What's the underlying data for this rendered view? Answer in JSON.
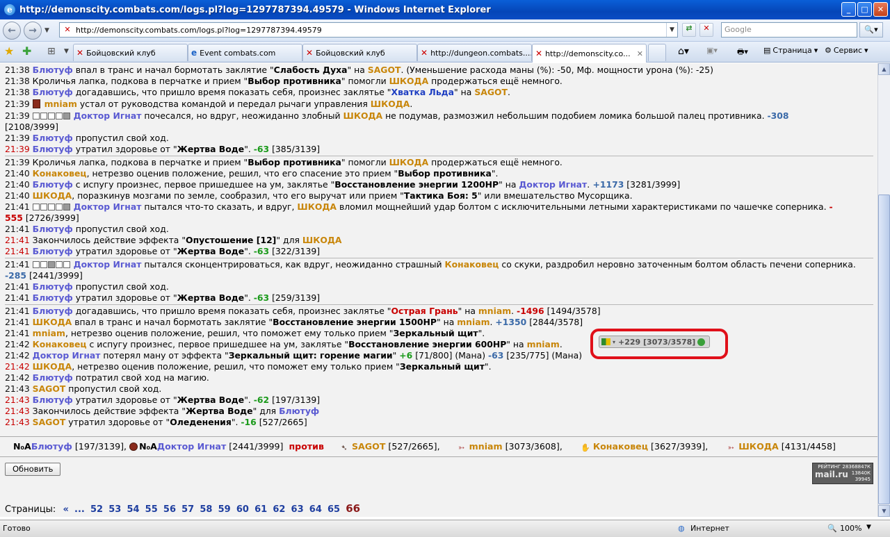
{
  "window": {
    "title": "http://demonscity.combats.com/logs.pl?log=1297787394.49579 - Windows Internet Explorer",
    "btn_min": "_",
    "btn_max": "□",
    "btn_close": "✕"
  },
  "address": {
    "url": "http://demonscity.combats.com/logs.pl?log=1297787394.49579",
    "search_placeholder": "Google"
  },
  "tabs": [
    {
      "label": "Бойцовский клуб"
    },
    {
      "label": "Event combats.com"
    },
    {
      "label": "Бойцовский клуб"
    },
    {
      "label": "http://dungeon.combats...."
    },
    {
      "label": "http://demonscity.co...",
      "close": "✕"
    }
  ],
  "toolbar": {
    "page": "Страница",
    "service": "Сервис"
  },
  "log": [
    {
      "time": "21:38",
      "t1": "Блютуф",
      "t2": " впал в транс и начал бормотать заклятие \"",
      "t3": "Слабость Духа",
      "t4": "\" на ",
      "t5": "SAGOT",
      "t6": ". (Уменьшение расхода маны (%): -50, Мф. мощности урона (%): -25)"
    },
    {
      "time": "21:38",
      "t1": "Кроличья лапка, подкова в перчатке и прием \"",
      "t2": "Выбор противника",
      "t3": "\" помогли ",
      "t4": "ШКОДА",
      "t5": " продержаться ещё немного."
    },
    {
      "time": "21:38",
      "t1": "Блютуф",
      "t2": " догадавшись, что пришло время показать себя, произнес заклятье \"",
      "t3": "Хватка Льда",
      "t4": "\" на ",
      "t5": "SAGOT",
      "t6": "."
    },
    {
      "time": "21:39",
      "t1": "mniam",
      "t2": " устал от руководства командой и передал рычаги управления ",
      "t3": "ШКОДА",
      "t4": "."
    },
    {
      "time": "21:39",
      "t1": "Доктор Игнат",
      "t2": " почесался, но вдруг, неожиданно злобный ",
      "t3": "ШКОДА",
      "t4": " не подумав, размозжил небольшим подобием ломика большой палец противника. ",
      "t5": "-308",
      "t6": "[2108/3999]"
    },
    {
      "time": "21:39",
      "t1": "Блютуф",
      "t2": " пропустил свой ход."
    },
    {
      "time": "21:39",
      "t1": "Блютуф",
      "t2": " утратил здоровье от \"",
      "t3": "Жертва Воде",
      "t4": "\". ",
      "t5": "-63",
      "t6": " [385/3139]"
    },
    {
      "time": "21:39",
      "t1": "Кроличья лапка, подкова в перчатке и прием \"",
      "t2": "Выбор противника",
      "t3": "\" помогли ",
      "t4": "ШКОДА",
      "t5": " продержаться ещё немного."
    },
    {
      "time": "21:40",
      "t1": "Конаковец",
      "t2": ", нетрезво оценив положение, решил, что его спасение это прием \"",
      "t3": "Выбор противника",
      "t4": "\"."
    },
    {
      "time": "21:40",
      "t1": "Блютуф",
      "t2": " с испугу произнес, первое пришедшее на ум, заклятье \"",
      "t3": "Восстановление энергии 1200HP",
      "t4": "\" на ",
      "t5": "Доктор Игнат",
      "t6": ".",
      "t7": " +1173",
      "t8": " [3281/3999]"
    },
    {
      "time": "21:40",
      "t1": "ШКОДА",
      "t2": ", поразкинув мозгами по земле, сообразил, что его выручат или прием \"",
      "t3": "Тактика Боя: 5",
      "t4": "\" или вмешательство Мусорщика."
    },
    {
      "time": "21:41",
      "t1": "Доктор Игнат",
      "t2": " пытался что-то сказать, и вдруг, ",
      "t3": "ШКОДА",
      "t4": " вломил мощнейший удар болтом с исключительными летными характеристиками по чашечке соперника. ",
      "t5": "-",
      "t6": "555",
      "t7": " [2726/3999]"
    },
    {
      "time": "21:41",
      "t1": "Блютуф",
      "t2": " пропустил свой ход."
    },
    {
      "time": "21:41",
      "t1": "Закончилось действие эффекта \"",
      "t2": "Опустошение [12]",
      "t3": "\" для ",
      "t4": "ШКОДА"
    },
    {
      "time": "21:41",
      "t1": "Блютуф",
      "t2": " утратил здоровье от \"",
      "t3": "Жертва Воде",
      "t4": "\". ",
      "t5": "-63",
      "t6": " [322/3139]"
    },
    {
      "time": "21:41",
      "t1": "Доктор Игнат",
      "t2": " пытался сконцентрироваться, как вдруг, неожиданно страшный ",
      "t3": "Конаковец",
      "t4": " со скуки, раздробил неровно заточенным болтом область печени соперника. ",
      "t5": "-285",
      "t6": " [2441/3999]"
    },
    {
      "time": "21:41",
      "t1": "Блютуф",
      "t2": " пропустил свой ход."
    },
    {
      "time": "21:41",
      "t1": "Блютуф",
      "t2": " утратил здоровье от \"",
      "t3": "Жертва Воде",
      "t4": "\". ",
      "t5": "-63",
      "t6": " [259/3139]"
    },
    {
      "time": "21:41",
      "t1": "Блютуф",
      "t2": " догадавшись, что пришло время показать себя, произнес заклятье \"",
      "t3": "Острая Грань",
      "t4": "\" на ",
      "t5": "mniam",
      "t6": ". ",
      "t7": "-1496",
      "t8": " [1494/3578]"
    },
    {
      "time": "21:41",
      "t1": "ШКОДА",
      "t2": " впал в транс и начал бормотать заклятие \"",
      "t3": "Восстановление энергии 1500HP",
      "t4": "\" на ",
      "t5": "mniam",
      "t6": ". ",
      "t7": "+1350",
      "t8": " [2844/3578]"
    },
    {
      "time": "21:41",
      "t1": "mniam",
      "t2": ", нетрезво оценив положение, решил, что поможет ему только прием \"",
      "t3": "Зеркальный щит",
      "t4": "\"."
    },
    {
      "time": "21:42",
      "t1": "Конаковец",
      "t2": " с испугу произнес, первое пришедшее на ум, заклятье \"",
      "t3": "Восстановление энергии 600HP",
      "t4": "\" на ",
      "t5": "mniam",
      "t6": "."
    },
    {
      "time": "21:42",
      "t1": "Доктор Игнат",
      "t2": " потерял ману от эффекта \"",
      "t3": "Зеркальный щит: горение магии",
      "t4": "\" ",
      "t5": "+6",
      "t6": " [71/800] (Мана) ",
      "t7": "-63",
      "t8": " [235/775] (Мана)"
    },
    {
      "time": "21:42",
      "t1": "ШКОДА",
      "t2": ", нетрезво оценив положение, решил, что поможет ему только прием \"",
      "t3": "Зеркальный щит",
      "t4": "\"."
    },
    {
      "time": "21:42",
      "t1": "Блютуф",
      "t2": " потратил свой ход на магию."
    },
    {
      "time": "21:43",
      "t1": "SAGOT",
      "t2": " пропустил свой ход."
    },
    {
      "time": "21:43",
      "t1": "Блютуф",
      "t2": " утратил здоровье от \"",
      "t3": "Жертва Воде",
      "t4": "\". ",
      "t5": "-62",
      "t6": " [197/3139]"
    },
    {
      "time": "21:43",
      "t1": "Закончилось действие эффекта \"",
      "t2": "Жертва Воде",
      "t3": "\" для ",
      "t4": "Блютуф"
    },
    {
      "time": "21:43",
      "t1": "SAGOT",
      "t2": " утратил здоровье от \"",
      "t3": "Оледенения",
      "t4": "\". ",
      "t5": "-16",
      "t6": " [527/2665]"
    }
  ],
  "teams": {
    "p1_pre": "N₀A",
    "p1": "Блютуф",
    "p1_hp": " [197/3139],",
    "p2_pre": "N₀A",
    "p2": "Доктор Игнат",
    "p2_hp": " [2441/3999]",
    "vs": "против",
    "p3": "SAGOT",
    "p3_hp": " [527/2665],",
    "p4": "mniam",
    "p4_hp": " [3073/3608],",
    "p5": "Конаковец",
    "p5_hp": " [3627/3939],",
    "p6": "ШКОДА",
    "p6_hp": " [4131/4458]"
  },
  "refresh_label": "Обновить",
  "counter": {
    "l1": "РЕЙТИНГ 28368847К",
    "l2": "13840К",
    "l3": "39945",
    "brand": "mail.ru"
  },
  "pages": {
    "label": "Страницы:",
    "prev": "«",
    "ellipsis": "...",
    "list": [
      "52",
      "53",
      "54",
      "55",
      "56",
      "57",
      "58",
      "59",
      "60",
      "61",
      "62",
      "63",
      "64",
      "65"
    ],
    "current": "66"
  },
  "popup": {
    "text": "+229 [3073/3578]"
  },
  "status": {
    "left": "Готово",
    "zone": "Интернет",
    "zoom": "100%"
  }
}
